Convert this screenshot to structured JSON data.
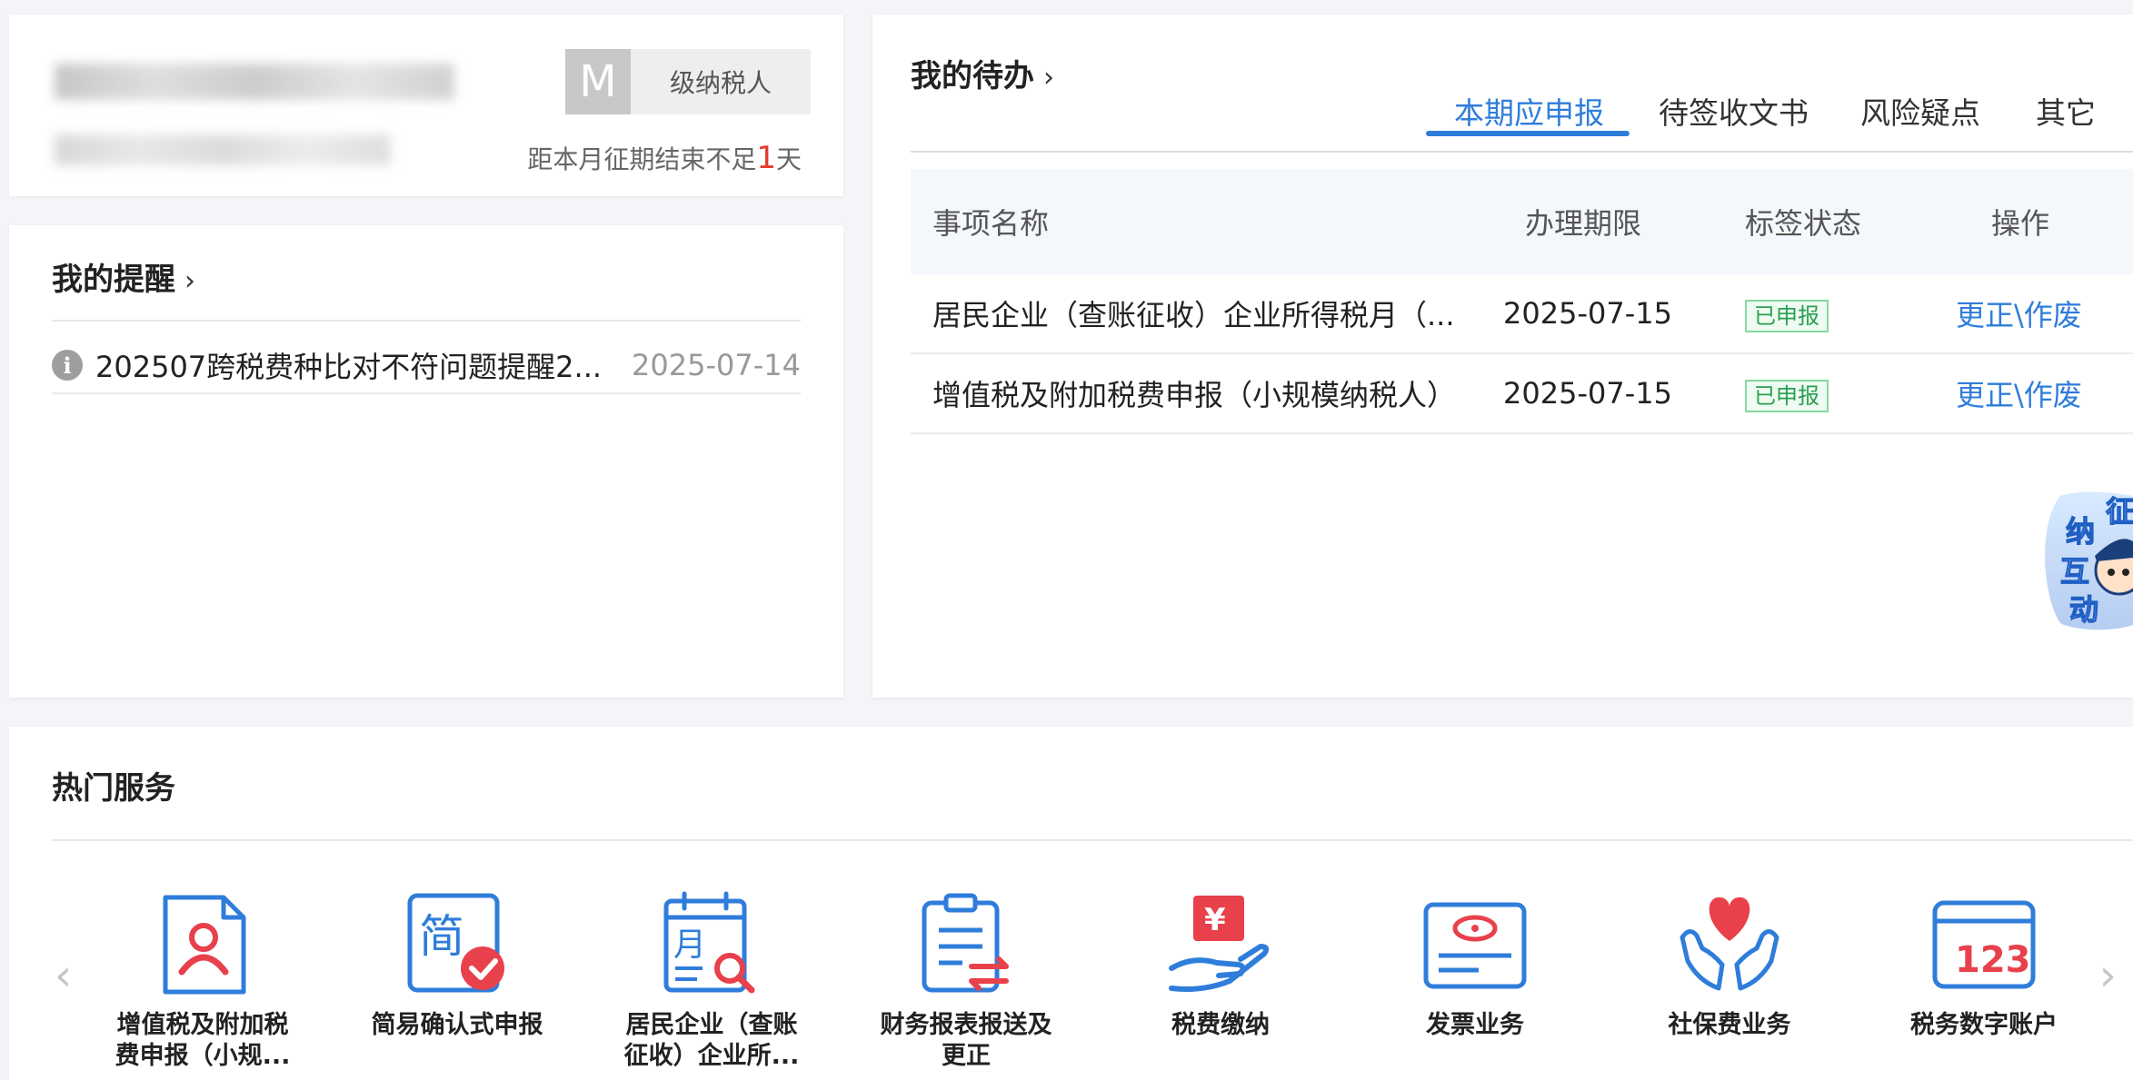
{
  "account": {
    "taxpayer_initial": "M",
    "taxpayer_type": "级纳税人",
    "deadline_prefix": "距本月征期结束不足",
    "deadline_days": "1",
    "deadline_suffix": "天"
  },
  "reminders": {
    "title": "我的提醒",
    "items": [
      {
        "text": "202507跨税费种比对不符问题提醒2...",
        "date": "2025-07-14"
      }
    ]
  },
  "todo": {
    "title": "我的待办",
    "tabs": [
      {
        "label": "本期应申报",
        "active": true
      },
      {
        "label": "待签收文书",
        "active": false
      },
      {
        "label": "风险疑点",
        "active": false
      },
      {
        "label": "其它",
        "active": false
      }
    ],
    "columns": [
      "事项名称",
      "办理期限",
      "标签状态",
      "操作"
    ],
    "rows": [
      {
        "name": "居民企业（查账征收）企业所得税月（...",
        "deadline": "2025-07-15",
        "status": "已申报",
        "action": "更正\\作废"
      },
      {
        "name": "增值税及附加税费申报（小规模纳税人）",
        "deadline": "2025-07-15",
        "status": "已申报",
        "action": "更正\\作废"
      }
    ],
    "mascot_text": [
      "征",
      "纳",
      "互",
      "动"
    ]
  },
  "services": {
    "title": "热门服务",
    "items": [
      {
        "label_line1": "增值税及附加税",
        "label_line2": "费申报（小规...",
        "icon": "vat-declaration-icon"
      },
      {
        "label_line1": "简易确认式申报",
        "label_line2": "",
        "icon": "simple-confirm-icon"
      },
      {
        "label_line1": "居民企业（查账",
        "label_line2": "征收）企业所...",
        "icon": "monthly-calendar-icon"
      },
      {
        "label_line1": "财务报表报送及",
        "label_line2": "更正",
        "icon": "financial-report-icon"
      },
      {
        "label_line1": "税费缴纳",
        "label_line2": "",
        "icon": "tax-payment-icon"
      },
      {
        "label_line1": "发票业务",
        "label_line2": "",
        "icon": "invoice-icon"
      },
      {
        "label_line1": "社保费业务",
        "label_line2": "",
        "icon": "social-insurance-icon"
      },
      {
        "label_line1": "税务数字账户",
        "label_line2": "",
        "icon": "digital-account-icon"
      }
    ],
    "digital_account_glyph": "123",
    "simple_glyph": "简",
    "month_glyph": "月",
    "yen_glyph": "¥"
  },
  "colors": {
    "accent": "#2f7ddb",
    "icon_red": "#e8414c",
    "success": "#2aa04f"
  }
}
